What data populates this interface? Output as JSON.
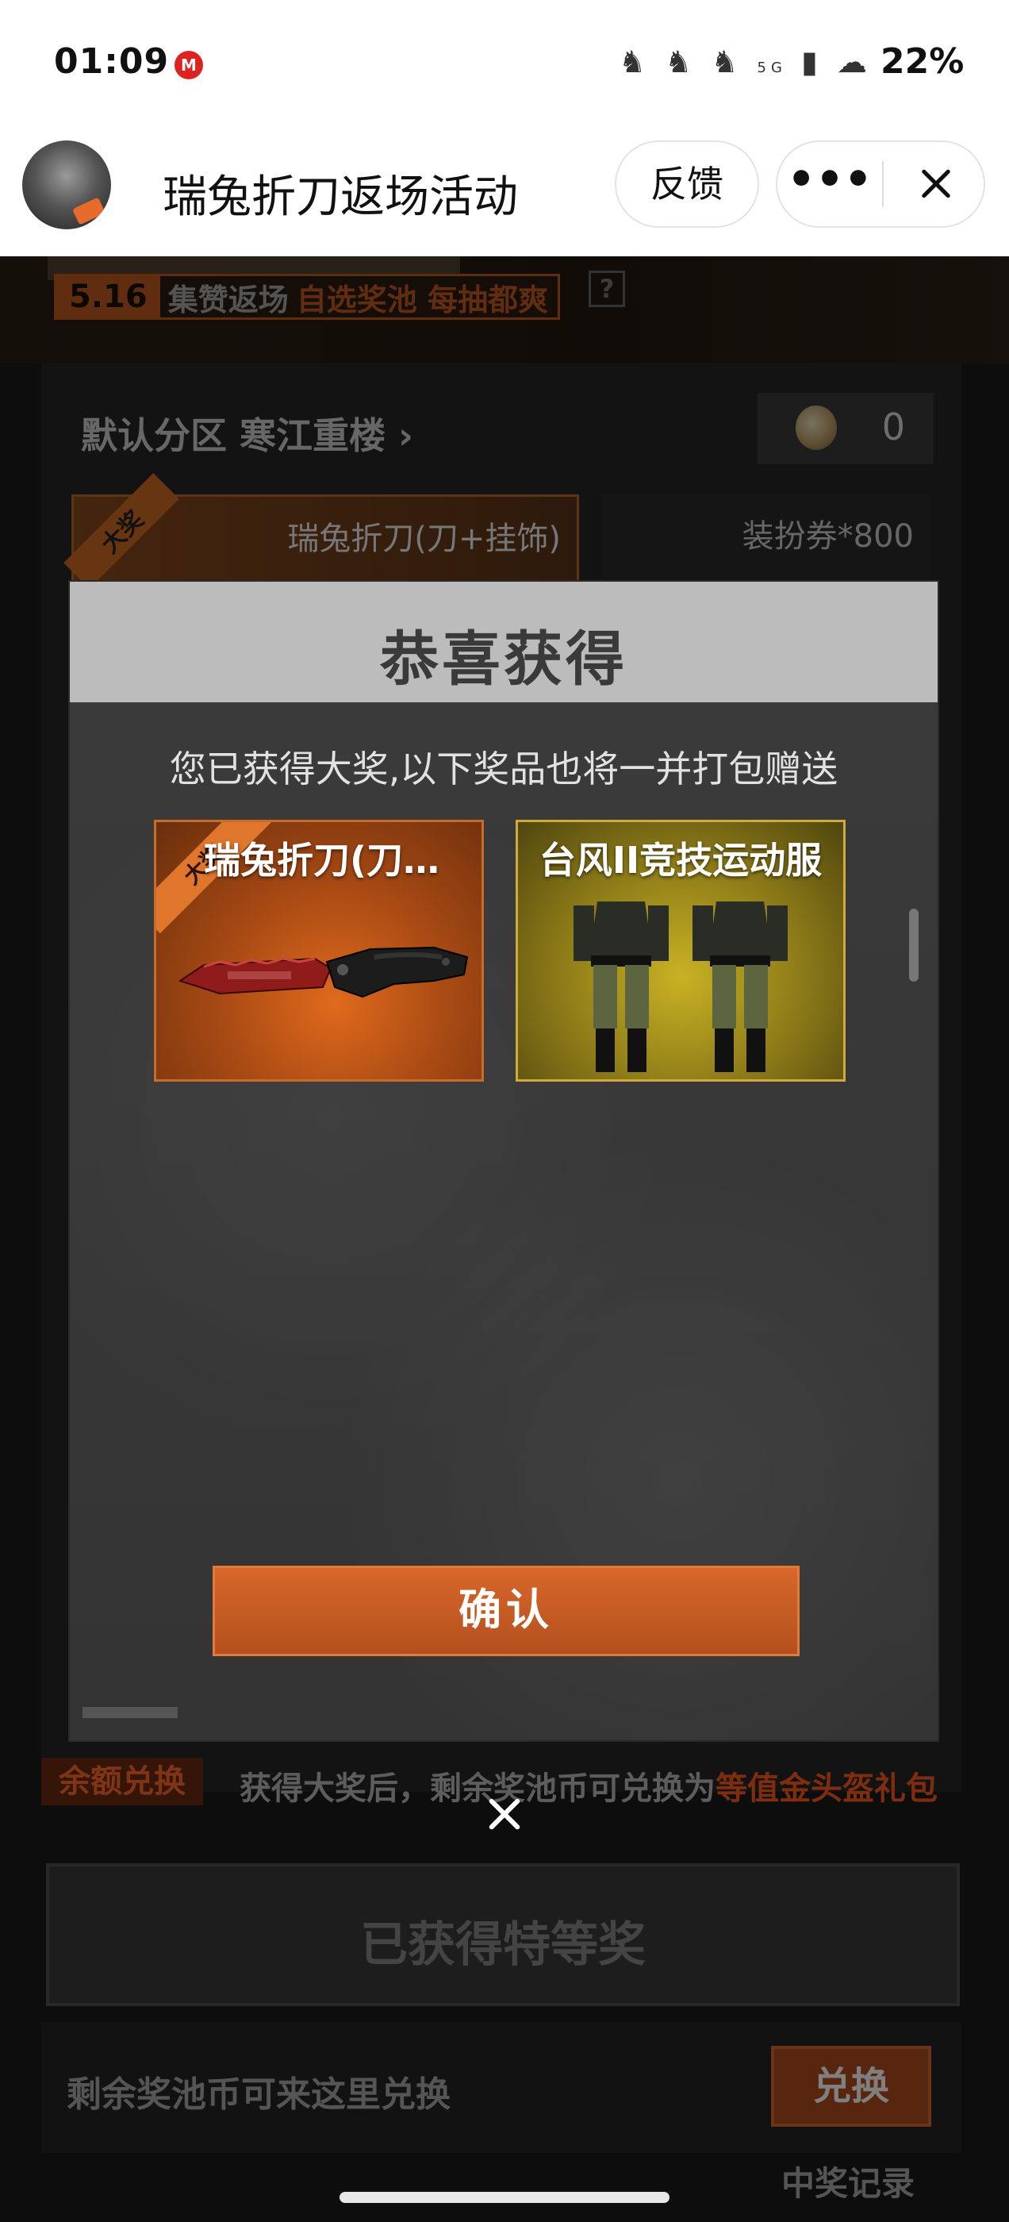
{
  "status_bar": {
    "time": "01:09",
    "app_icon": "M",
    "network": "5G",
    "battery": "22%"
  },
  "header": {
    "title": "瑞兔折刀返场活动",
    "feedback_label": "反馈",
    "more_label": "•••"
  },
  "banner": {
    "date": "5.16",
    "text1": "集赞返场",
    "text2": "自选奖池 每抽都爽",
    "help": "?"
  },
  "background": {
    "server_label": "默认分区 寒江重楼 ›",
    "coin_count": "0",
    "prize_main_badge": "大奖",
    "prize_main": "瑞兔折刀(刀+挂饰)",
    "prize_second": "装扮券*800",
    "redeem_tag": "余额兑换",
    "redeem_text": "获得大奖后，剩余奖池币可兑换为",
    "redeem_highlight": "等值金头盔礼包",
    "obtained_label": "已获得特等奖",
    "exchange_text": "剩余奖池币可来这里兑换",
    "exchange_button": "兑换",
    "records_label": "中奖记录"
  },
  "modal": {
    "title": "恭喜获得",
    "subtitle": "您已获得大奖,以下奖品也将一并打包赠送",
    "items": [
      {
        "name": "瑞兔折刀(刀…",
        "badge": "大奖"
      },
      {
        "name": "台风II竞技运动服"
      }
    ],
    "confirm_label": "确认"
  },
  "colors": {
    "accent": "#c25b21",
    "card_gold": "#d0aa3a"
  }
}
